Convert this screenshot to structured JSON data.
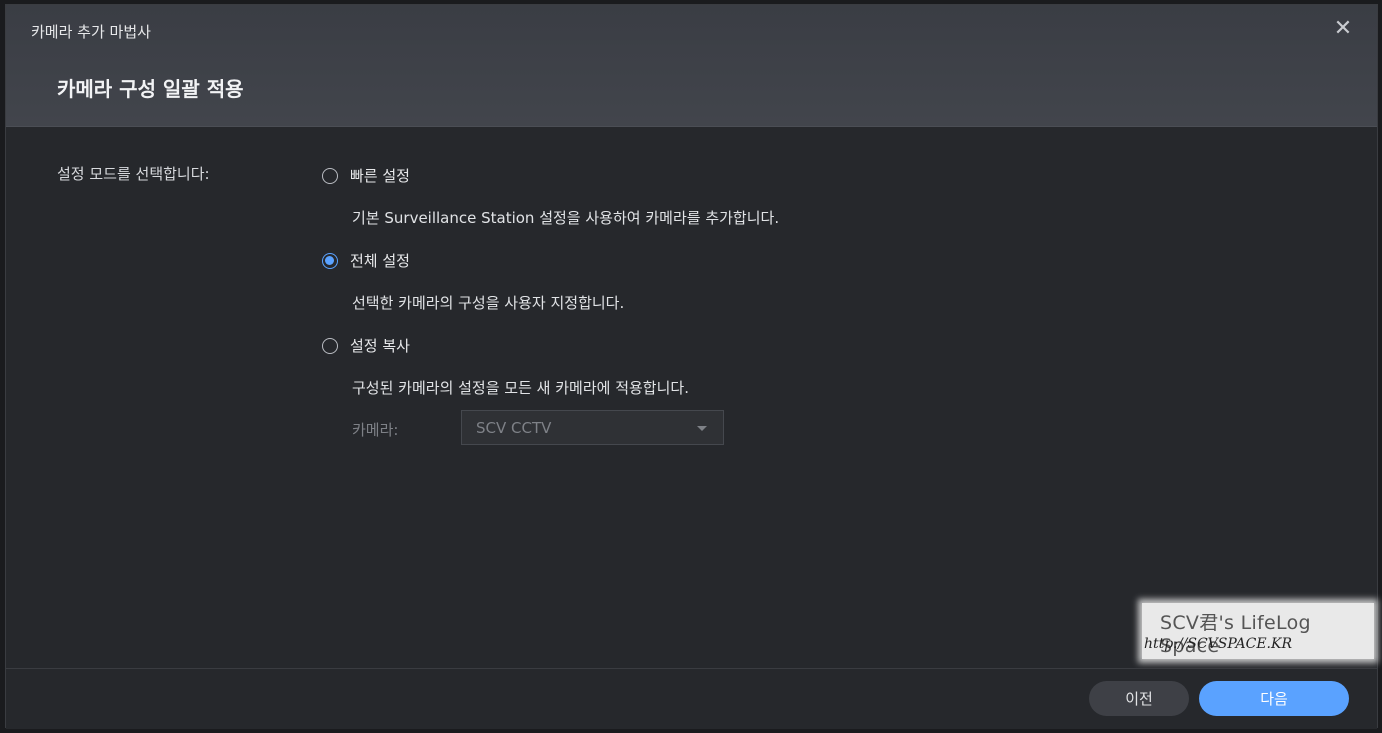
{
  "dialog": {
    "wizard_title": "카메라 추가 마법사",
    "page_title": "카메라 구성 일괄 적용",
    "close_icon": "close-icon"
  },
  "form": {
    "mode_label": "설정 모드를 선택합니다:",
    "options": [
      {
        "label": "빠른 설정",
        "description": "기본 Surveillance Station 설정을 사용하여 카메라를 추가합니다.",
        "checked": false
      },
      {
        "label": "전체 설정",
        "description": "선택한 카메라의 구성을 사용자 지정합니다.",
        "checked": true
      },
      {
        "label": "설정 복사",
        "description": "구성된 카메라의 설정을 모든 새 카메라에 적용합니다.",
        "checked": false
      }
    ],
    "camera_label": "카메라:",
    "camera_select_value": "SCV CCTV"
  },
  "watermark": {
    "title": "SCV君's LifeLog Space",
    "url": "http://SCVSPACE.KR"
  },
  "footer": {
    "prev_label": "이전",
    "next_label": "다음"
  },
  "colors": {
    "accent": "#5aa2ff",
    "background": "#26282c",
    "header": "#3d4047"
  }
}
